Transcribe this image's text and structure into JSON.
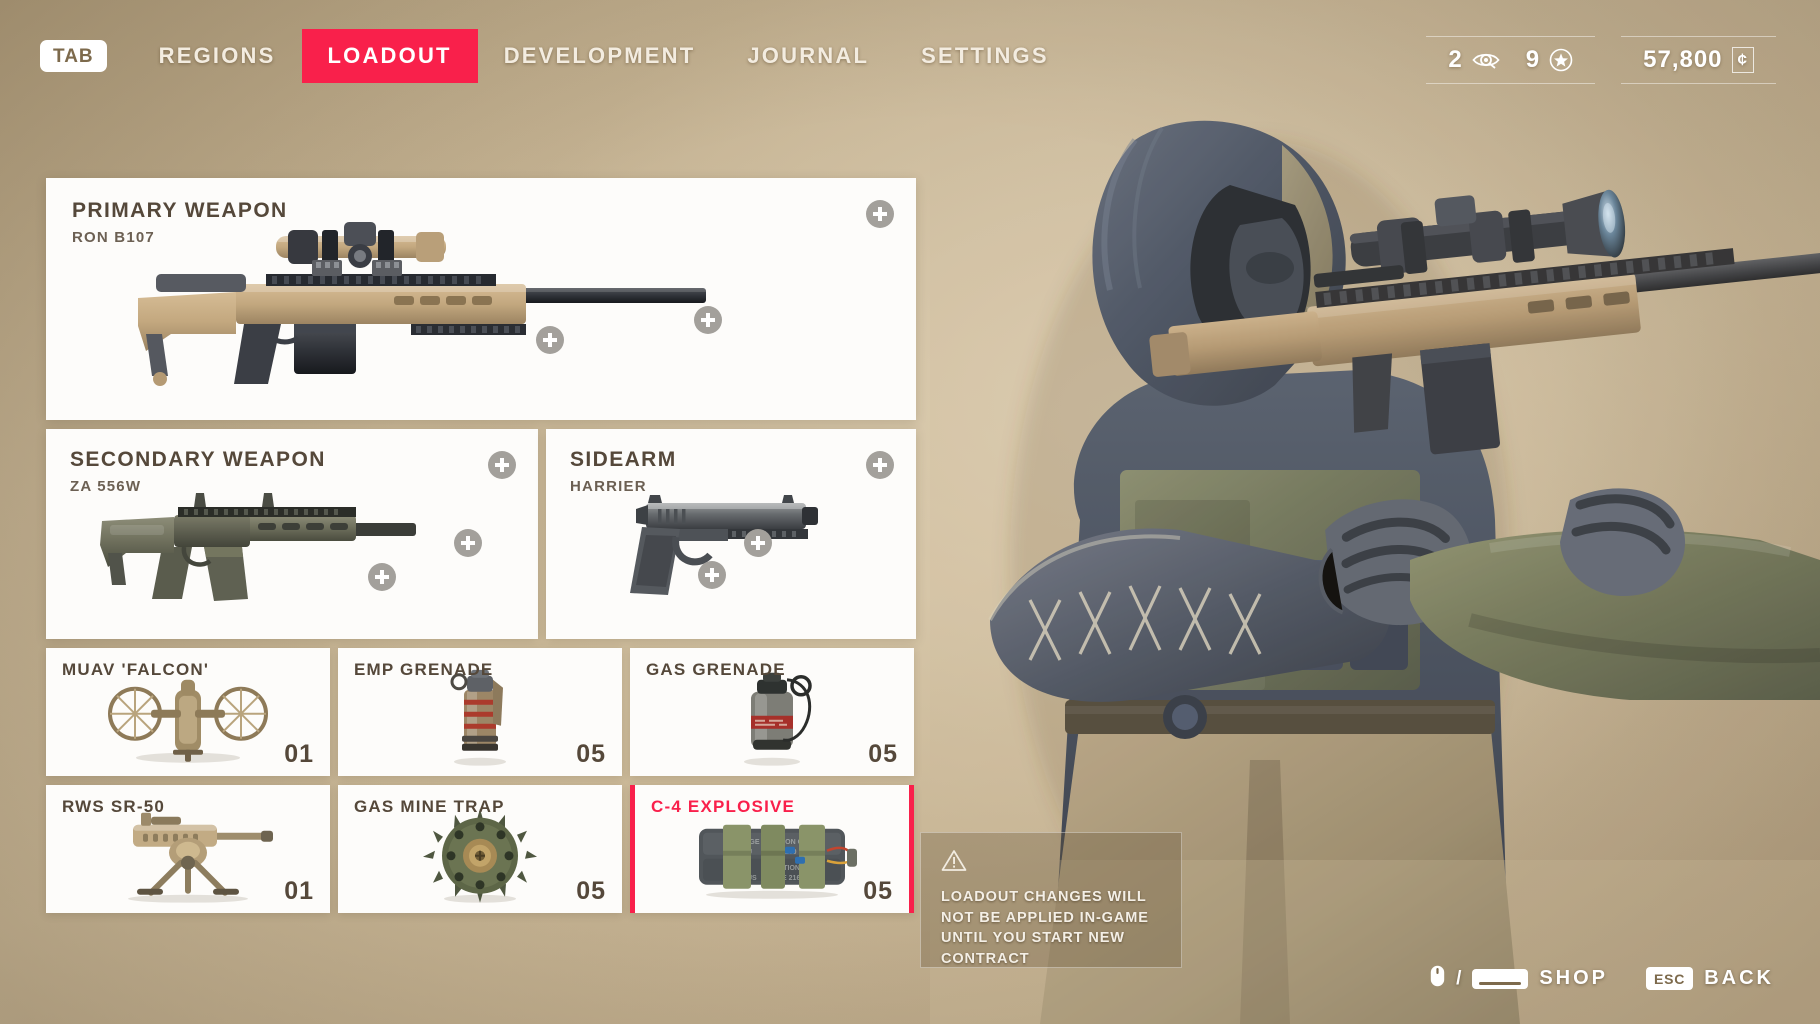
{
  "nav": {
    "tab_key": "TAB",
    "items": [
      {
        "label": "REGIONS",
        "active": false
      },
      {
        "label": "LOADOUT",
        "active": true
      },
      {
        "label": "DEVELOPMENT",
        "active": false
      },
      {
        "label": "JOURNAL",
        "active": false
      },
      {
        "label": "SETTINGS",
        "active": false
      }
    ],
    "accent_color": "#f9204b"
  },
  "stats": {
    "intel": {
      "value": "2",
      "icon": "eye-icon"
    },
    "stars": {
      "value": "9",
      "icon": "star-icon"
    },
    "currency": {
      "value": "57,800",
      "symbol": "¢",
      "icon": "currency-icon"
    }
  },
  "loadout": {
    "primary": {
      "title": "PRIMARY WEAPON",
      "name": "RON B107"
    },
    "secondary": {
      "title": "SECONDARY WEAPON",
      "name": "ZA 556W"
    },
    "sidearm": {
      "title": "SIDEARM",
      "name": "HARRIER"
    },
    "gadgets": [
      {
        "name": "MUAV 'FALCON'",
        "qty": "01",
        "selected": false,
        "icon": "drone-icon"
      },
      {
        "name": "EMP GRENADE",
        "qty": "05",
        "selected": false,
        "icon": "emp-grenade-icon"
      },
      {
        "name": "GAS GRENADE",
        "qty": "05",
        "selected": false,
        "icon": "gas-grenade-icon"
      },
      {
        "name": "RWS SR-50",
        "qty": "01",
        "selected": false,
        "icon": "turret-icon"
      },
      {
        "name": "GAS MINE TRAP",
        "qty": "05",
        "selected": false,
        "icon": "mine-icon"
      },
      {
        "name": "C-4 EXPLOSIVE",
        "qty": "05",
        "selected": true,
        "icon": "c4-icon"
      }
    ]
  },
  "warning": {
    "icon": "warning-triangle-icon",
    "text": "LOADOUT CHANGES WILL NOT BE APPLIED IN-GAME UNTIL YOU START NEW CONTRACT"
  },
  "prompts": {
    "shop": {
      "label": "SHOP",
      "mouse_icon": "mouse-icon",
      "separator": "/",
      "key": "space-key"
    },
    "back": {
      "label": "BACK",
      "key": "ESC"
    }
  },
  "theme": {
    "background": "#c7b595",
    "card_bg": "#fdfcfa",
    "accent": "#f9204b",
    "title_text": "#55483a"
  }
}
